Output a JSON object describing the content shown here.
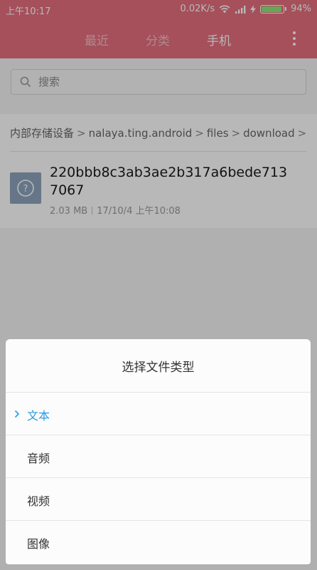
{
  "status_bar": {
    "time": "上午10:17",
    "speed": "0.02K/s",
    "battery": "94%",
    "battery_level": 0.94
  },
  "header": {
    "tabs": [
      {
        "label": "最近",
        "active": false
      },
      {
        "label": "分类",
        "active": false
      },
      {
        "label": "手机",
        "active": true
      }
    ],
    "more_icon": "more-vertical-icon"
  },
  "search": {
    "placeholder": "搜索",
    "value": ""
  },
  "breadcrumb": {
    "items": [
      "内部存储设备",
      "nalaya.ting.android",
      "files",
      "download"
    ]
  },
  "file": {
    "name": "220bbb8c3ab3ae2b317a6bede7137067",
    "size": "2.03 MB",
    "date": "17/10/4 上午10:08",
    "icon": "unknown-file-icon"
  },
  "dialog": {
    "title": "选择文件类型",
    "options": [
      {
        "label": "文本",
        "selected": true
      },
      {
        "label": "音频",
        "selected": false
      },
      {
        "label": "视频",
        "selected": false
      },
      {
        "label": "图像",
        "selected": false
      }
    ]
  },
  "colors": {
    "header_bg": "#e56f7e",
    "accent": "#2b9be0",
    "file_icon_bg": "#8ea4bd"
  }
}
